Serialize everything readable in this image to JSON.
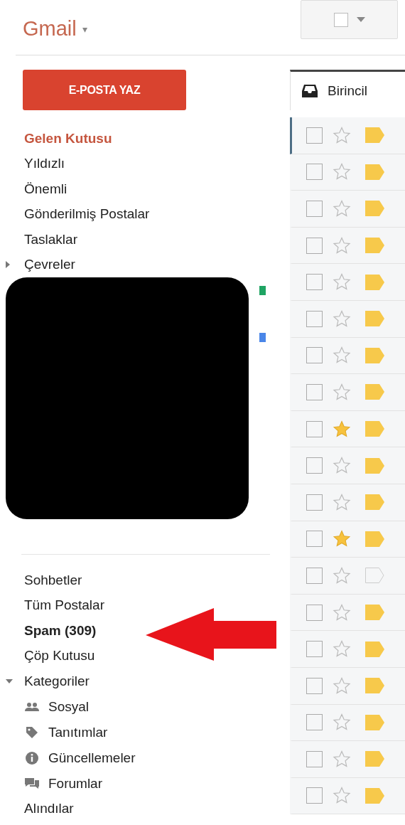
{
  "header": {
    "logo": "Gmail",
    "caret": "▾"
  },
  "compose": {
    "label": "E-POSTA YAZ"
  },
  "nav": [
    {
      "label": "Gelen Kutusu",
      "selected": true,
      "bold": false
    },
    {
      "label": "Yıldızlı",
      "selected": false,
      "bold": false
    },
    {
      "label": "Önemli",
      "selected": false,
      "bold": false
    },
    {
      "label": "Gönderilmiş Postalar",
      "selected": false,
      "bold": false
    },
    {
      "label": "Taslaklar",
      "selected": false,
      "bold": false
    },
    {
      "label": "Çevreler",
      "selected": false,
      "bold": false,
      "expanded": false
    }
  ],
  "labels": [
    {
      "color": "#1fa463"
    },
    {
      "color": "#4a86e8"
    }
  ],
  "nav_more": [
    {
      "label": "Sohbetler",
      "selected": false,
      "bold": false
    },
    {
      "label": "Tüm Postalar",
      "selected": false,
      "bold": false
    },
    {
      "label": "Spam (309)",
      "selected": false,
      "bold": true
    },
    {
      "label": "Çöp Kutusu",
      "selected": false,
      "bold": false
    },
    {
      "label": "Kategoriler",
      "selected": false,
      "bold": false,
      "expanded": true
    }
  ],
  "categories": [
    {
      "label": "Sosyal",
      "kind": "people"
    },
    {
      "label": "Tanıtımlar",
      "kind": "tag"
    },
    {
      "label": "Güncellemeler",
      "kind": "info"
    },
    {
      "label": "Forumlar",
      "kind": "chat"
    }
  ],
  "nav_last": [
    {
      "label": "Alındılar",
      "selected": false,
      "bold": false
    }
  ],
  "tab": {
    "label": "Birincil",
    "selected": true
  },
  "rows": [
    {
      "checked": false,
      "starred": false,
      "important": true,
      "focused": true
    },
    {
      "checked": false,
      "starred": false,
      "important": true,
      "focused": false
    },
    {
      "checked": false,
      "starred": false,
      "important": true,
      "focused": false
    },
    {
      "checked": false,
      "starred": false,
      "important": true,
      "focused": false
    },
    {
      "checked": false,
      "starred": false,
      "important": true,
      "focused": false
    },
    {
      "checked": false,
      "starred": false,
      "important": true,
      "focused": false
    },
    {
      "checked": false,
      "starred": false,
      "important": true,
      "focused": false
    },
    {
      "checked": false,
      "starred": false,
      "important": true,
      "focused": false
    },
    {
      "checked": false,
      "starred": true,
      "important": true,
      "focused": false
    },
    {
      "checked": false,
      "starred": false,
      "important": true,
      "focused": false
    },
    {
      "checked": false,
      "starred": false,
      "important": true,
      "focused": false
    },
    {
      "checked": false,
      "starred": true,
      "important": true,
      "focused": false
    },
    {
      "checked": false,
      "starred": false,
      "important": false,
      "focused": false
    },
    {
      "checked": false,
      "starred": false,
      "important": true,
      "focused": false
    },
    {
      "checked": false,
      "starred": false,
      "important": true,
      "focused": false
    },
    {
      "checked": false,
      "starred": false,
      "important": true,
      "focused": false
    },
    {
      "checked": false,
      "starred": false,
      "important": true,
      "focused": false
    },
    {
      "checked": false,
      "starred": false,
      "important": true,
      "focused": false
    },
    {
      "checked": false,
      "starred": false,
      "important": true,
      "focused": false
    }
  ]
}
